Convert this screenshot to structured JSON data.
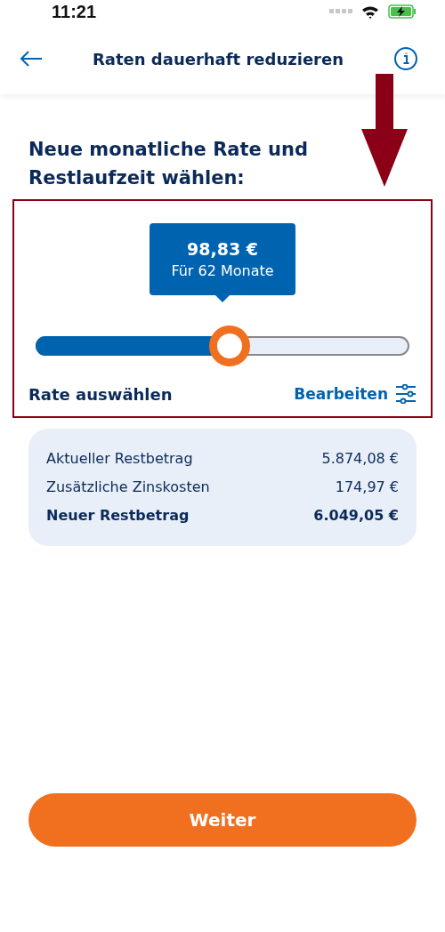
{
  "status_bar": {
    "time": "11:21"
  },
  "nav": {
    "title": "Raten dauerhaft reduzieren"
  },
  "heading": "Neue monatliche Rate und Restlaufzeit wählen:",
  "slider": {
    "amount": "98,83 €",
    "duration": "Für 62 Monate",
    "level": 0.52,
    "label": "Rate auswählen",
    "edit": "Bearbeiten"
  },
  "summary": [
    {
      "label": "Aktueller Restbetrag",
      "value": "5.874,08 €",
      "emphasis": false
    },
    {
      "label": "Zusätzliche Zinskosten",
      "value": "174,97 €",
      "emphasis": false
    },
    {
      "label": "Neuer Restbetrag",
      "value": "6.049,05 €",
      "emphasis": true
    }
  ],
  "primary_button": "Weiter"
}
